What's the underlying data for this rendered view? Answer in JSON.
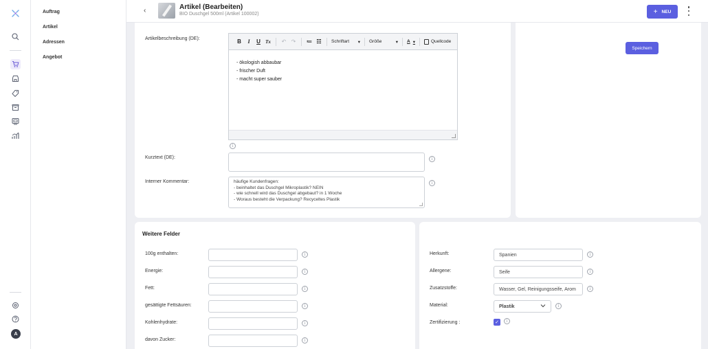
{
  "header": {
    "back": "‹",
    "title": "Artikel (Bearbeiten)",
    "subtitle": "BIO Duschgel 500ml (Artikel 100002)",
    "new_button": "NEU",
    "new_plus": "+"
  },
  "nav": {
    "items": [
      "Auftrag",
      "Artikel",
      "Adressen",
      "Angebot"
    ]
  },
  "rail": {
    "avatar": "A",
    "icons": [
      "app-logo-icon",
      "search-icon",
      "cart-icon",
      "store-icon",
      "tag-icon",
      "package-icon",
      "photo-icon",
      "chart-icon",
      "settings-icon",
      "help-icon"
    ],
    "accent": "#5b5fe0"
  },
  "description": {
    "label": "Artikelbeschreibung (DE):",
    "toolbar": {
      "bold": "B",
      "italic": "I",
      "underline": "U",
      "clear": "Tx",
      "undo": "↶",
      "redo": "↷",
      "ordered_list": "≔",
      "bullet_list": "☷",
      "font": "Schriftart",
      "size": "Größe",
      "color": "A",
      "source": "Quellcode"
    },
    "lines": [
      "- ökologish abbaubar",
      "- frischer Duft",
      "- macht super sauber"
    ]
  },
  "kurztext": {
    "label": "Kurztext (DE):",
    "value": ""
  },
  "kommentar": {
    "label": "Interner Kommentar:",
    "lines": [
      "häufige Kundenfragen:",
      "- beinhaltet das Duschgel Mikroplastik? NEIN",
      "- wie schnell wird das Duschgel abgebaut? in 1 Woche",
      "- Woraus besteht die Verpackung? Recyceltes Plastik"
    ]
  },
  "save_button": "Speichern",
  "weitere": {
    "title": "Weitere Felder",
    "fields": [
      {
        "label": "100g enthalten:",
        "value": ""
      },
      {
        "label": "Energie:",
        "value": ""
      },
      {
        "label": "Fett:",
        "value": ""
      },
      {
        "label": "gesättigte Fettsäuren:",
        "value": ""
      },
      {
        "label": "Kohlenhydrate:",
        "value": ""
      },
      {
        "label": "davon Zucker:",
        "value": ""
      }
    ]
  },
  "right_fields": {
    "herkunft": {
      "label": "Herkunft:",
      "value": "Spanien"
    },
    "allergene": {
      "label": "Allergene:",
      "value": "Seife"
    },
    "zusatzstoffe": {
      "label": "Zusatzstoffe:",
      "value": "Wasser, Gel, Reinigungsseife, Arom"
    },
    "material": {
      "label": "Material:",
      "value": "Plastik"
    },
    "zertifizierung": {
      "label": "Zertifizierung :",
      "checked": true,
      "check": "✓"
    }
  },
  "info_glyph": "i"
}
